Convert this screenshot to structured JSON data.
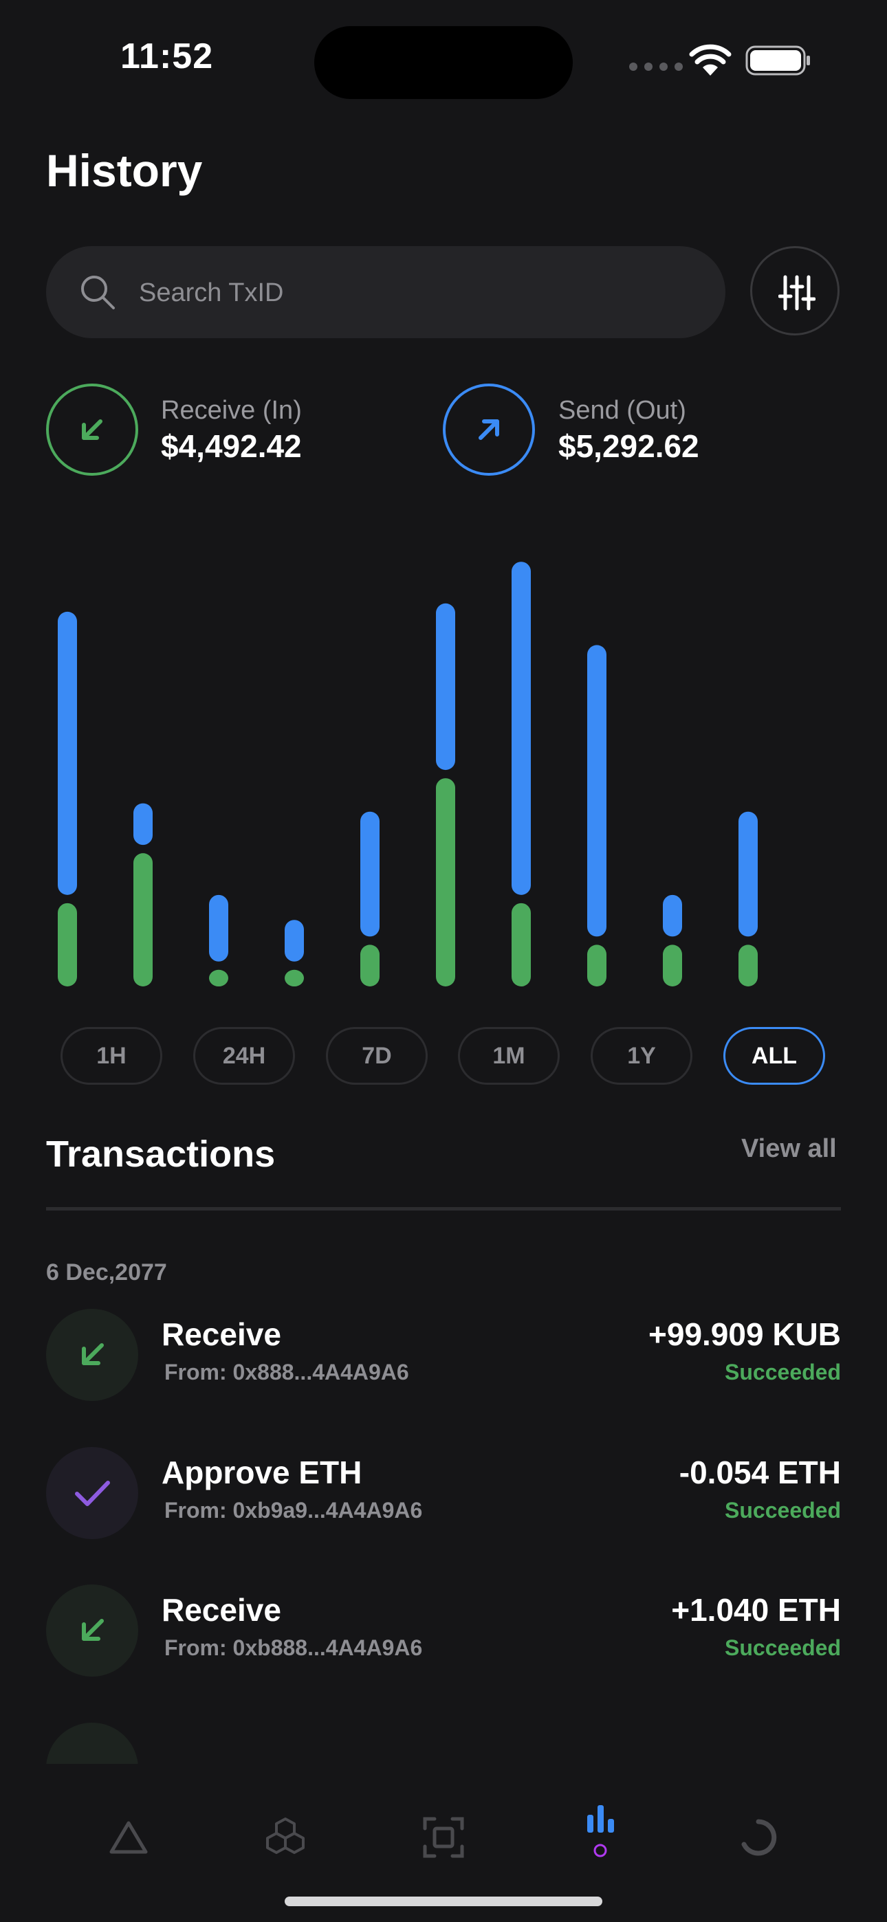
{
  "status_bar": {
    "time": "11:52"
  },
  "header": {
    "title": "History"
  },
  "search": {
    "placeholder": "Search TxID",
    "value": ""
  },
  "summary": {
    "receive": {
      "label": "Receive (In)",
      "value": "$4,492.42"
    },
    "send": {
      "label": "Send (Out)",
      "value": "$5,292.62"
    }
  },
  "colors": {
    "receive": "#4caa5c",
    "send": "#3b8bf5",
    "approve": "#8e5be0",
    "background": "#151517"
  },
  "chart_data": {
    "type": "bar",
    "stacked": true,
    "categories": [
      "1",
      "2",
      "3",
      "4",
      "5",
      "6",
      "7",
      "8",
      "9",
      "10"
    ],
    "series": [
      {
        "values": [
          1.0,
          1.6,
          0.2,
          0.2,
          0.5,
          2.5,
          1.0,
          0.5,
          0.5,
          0.5
        ]
      },
      {
        "values": [
          3.4,
          0.5,
          0.8,
          0.5,
          1.5,
          2.0,
          4.0,
          3.5,
          0.5,
          1.5
        ]
      }
    ],
    "ylim": [
      0,
      5.2
    ],
    "grid": false
  },
  "ranges": [
    {
      "label": "1H",
      "active": false
    },
    {
      "label": "24H",
      "active": false
    },
    {
      "label": "7D",
      "active": false
    },
    {
      "label": "1M",
      "active": false
    },
    {
      "label": "1Y",
      "active": false
    },
    {
      "label": "ALL",
      "active": true
    }
  ],
  "transactions": {
    "title": "Transactions",
    "view_all": "View all",
    "date": "6 Dec,2077",
    "items": [
      {
        "icon": "arrow-down-left-icon",
        "type": "Receive",
        "from": "From: 0x888...4A4A9A6",
        "amount": "+99.909 KUB",
        "status": "Succeeded"
      },
      {
        "icon": "check-icon",
        "type": "Approve ETH",
        "from": "From: 0xb9a9...4A4A9A6",
        "amount": "-0.054 ETH",
        "status": "Succeeded"
      },
      {
        "icon": "arrow-down-left-icon",
        "type": "Receive",
        "from": "From: 0xb888...4A4A9A6",
        "amount": "+1.040 ETH",
        "status": "Succeeded"
      }
    ]
  },
  "tabs": [
    "triangle-icon",
    "cubes-icon",
    "scan-icon",
    "chart-icon",
    "circle-progress-icon"
  ],
  "active_tab": "chart-icon"
}
